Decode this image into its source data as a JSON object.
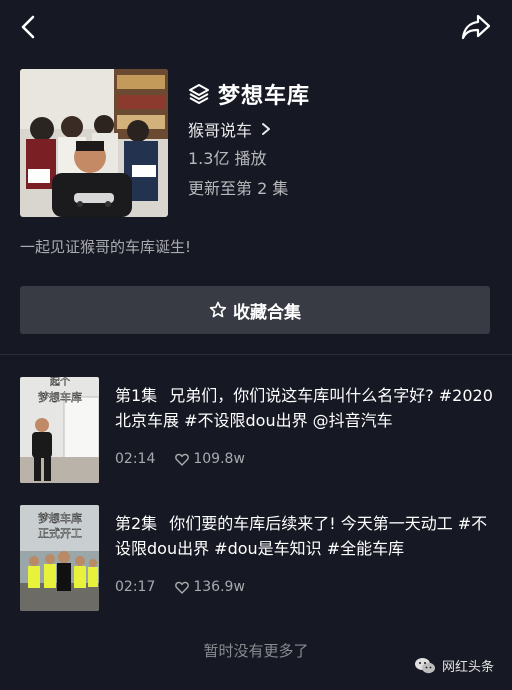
{
  "topbar": {
    "back_icon": "chevron-left-icon",
    "share_icon": "share-arrow-icon"
  },
  "collection": {
    "title": "梦想车库",
    "author": "猴哥说车",
    "plays": "1.3亿 播放",
    "updated": "更新至第 2 集",
    "description": "一起见证猴哥的车库诞生!",
    "cover_icon": "stack-icon"
  },
  "collect_button": {
    "label": "收藏合集",
    "icon": "star-outline-icon"
  },
  "episodes": [
    {
      "number": "第1集",
      "title": "兄弟们，你们说这车库叫什么名字好? #2020北京车展 #不设限dou出界 @抖音汽车",
      "duration": "02:14",
      "likes": "109.8w",
      "thumb_caption_line1": "起个",
      "thumb_caption_line2": "梦想车库"
    },
    {
      "number": "第2集",
      "title": "你们要的车库后续来了! 今天第一天动工 #不设限dou出界 #dou是车知识 #全能车库",
      "duration": "02:17",
      "likes": "136.9w",
      "thumb_caption_line1": "梦想车库",
      "thumb_caption_line2": "正式开工"
    }
  ],
  "footer": {
    "no_more": "暂时没有更多了"
  },
  "watermark": {
    "text": "网红头条",
    "icon": "wechat-icon"
  },
  "colors": {
    "background": "#161823",
    "button": "#393b44",
    "text_secondary": "#a9aaae"
  }
}
